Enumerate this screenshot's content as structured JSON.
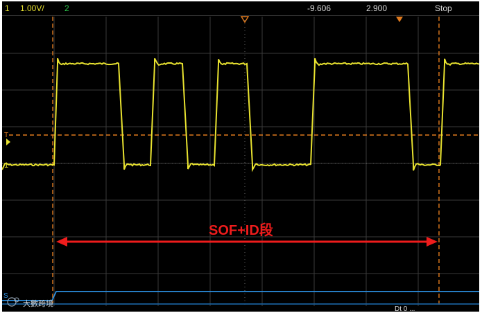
{
  "statusbar": {
    "ch1_number": "1",
    "ch1_scale": "1.00V/",
    "ch2_number": "2",
    "cursor_a": "-9.606",
    "cursor_b": "2.900",
    "run_state": "Stop"
  },
  "annotation": {
    "label": "SOF+ID段",
    "color": "#ee1c1c"
  },
  "markers": {
    "ch1_marker": "1",
    "trigger_marker": "T",
    "ch2_marker": "S"
  },
  "watermark": {
    "text": "大數跨境"
  },
  "bottom_right_text": "Dt 0 ...",
  "colors": {
    "ch1": "#e8e230",
    "ch2": "#2b8fe0",
    "cursor": "#e07a1e",
    "grid": "#3a3a3a",
    "arrow": "#ee1c1c"
  }
}
